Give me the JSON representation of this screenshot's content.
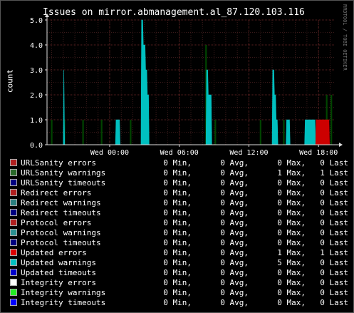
{
  "title": "Issues on mirror.abmanagement.al_87.120.103.116",
  "watermark": "RRDTOOL / TOBI OETIKER",
  "chart_data": {
    "type": "area",
    "ylabel": "count",
    "ylim": [
      0,
      5.0
    ],
    "yticks": [
      "0.0",
      "1.0",
      "2.0",
      "3.0",
      "4.0",
      "5.0"
    ],
    "xticks": [
      {
        "label": "Wed 00:00",
        "t": 5
      },
      {
        "label": "Wed 06:00",
        "t": 11
      },
      {
        "label": "Wed 12:00",
        "t": 17
      },
      {
        "label": "Wed 18:00",
        "t": 23
      }
    ],
    "xrange": [
      -0.4,
      24.4
    ],
    "grid": true,
    "series": [
      {
        "name": "URLSanity warnings",
        "color": "#004400",
        "style": "bars",
        "points": [
          [
            0.0,
            1.0
          ],
          [
            1.1,
            1.0
          ],
          [
            2.7,
            1.0
          ],
          [
            4.3,
            1.0
          ],
          [
            6.8,
            1.0
          ],
          [
            13.3,
            4.0
          ],
          [
            14.1,
            1.0
          ],
          [
            18.0,
            1.0
          ],
          [
            19.2,
            1.0
          ],
          [
            20.0,
            1.0
          ],
          [
            23.7,
            2.0
          ],
          [
            24.1,
            2.0
          ]
        ]
      },
      {
        "name": "Updated warnings",
        "color": "#00c0c0",
        "style": "area",
        "points": [
          [
            1.0,
            0
          ],
          [
            1.05,
            3.0
          ],
          [
            1.12,
            0
          ],
          [
            5.5,
            0
          ],
          [
            5.55,
            1.0
          ],
          [
            5.85,
            1.0
          ],
          [
            5.9,
            0
          ],
          [
            7.7,
            0
          ],
          [
            7.75,
            5.0
          ],
          [
            7.85,
            5.0
          ],
          [
            7.9,
            4.0
          ],
          [
            8.05,
            4.0
          ],
          [
            8.1,
            3.0
          ],
          [
            8.2,
            3.0
          ],
          [
            8.25,
            2.0
          ],
          [
            8.35,
            2.0
          ],
          [
            8.4,
            0
          ],
          [
            13.3,
            0
          ],
          [
            13.35,
            3.0
          ],
          [
            13.45,
            3.0
          ],
          [
            13.5,
            2.0
          ],
          [
            13.75,
            2.0
          ],
          [
            13.8,
            0
          ],
          [
            19.0,
            0
          ],
          [
            19.05,
            3.0
          ],
          [
            19.15,
            3.0
          ],
          [
            19.2,
            2.0
          ],
          [
            19.3,
            2.0
          ],
          [
            19.35,
            1.0
          ],
          [
            19.45,
            1.0
          ],
          [
            19.5,
            0
          ],
          [
            20.2,
            0
          ],
          [
            20.25,
            1.0
          ],
          [
            20.5,
            1.0
          ],
          [
            20.55,
            0
          ],
          [
            21.8,
            0
          ],
          [
            21.85,
            1.0
          ],
          [
            22.7,
            1.0
          ],
          [
            22.75,
            0
          ]
        ]
      },
      {
        "name": "Updated errors",
        "color": "#cc0000",
        "style": "area",
        "points": [
          [
            22.75,
            0
          ],
          [
            22.8,
            1.0
          ],
          [
            23.9,
            1.0
          ],
          [
            23.95,
            0
          ]
        ]
      }
    ]
  },
  "legend": [
    {
      "name": "URLSanity errors",
      "color": "#b02020",
      "min": "0 Min,",
      "avg": "0 Avg,",
      "max": "0 Max,",
      "last": "0 Last"
    },
    {
      "name": "URLSanity warnings",
      "color": "#2a6a2a",
      "min": "0 Min,",
      "avg": "0 Avg,",
      "max": "1 Max,",
      "last": "1 Last"
    },
    {
      "name": "URLSanity timeouts",
      "color": "#000080",
      "min": "0 Min,",
      "avg": "0 Avg,",
      "max": "0 Max,",
      "last": "0 Last"
    },
    {
      "name": "Redirect errors",
      "color": "#b02020",
      "min": "0 Min,",
      "avg": "0 Avg,",
      "max": "0 Max,",
      "last": "0 Last"
    },
    {
      "name": "Redirect warnings",
      "color": "#2a8080",
      "min": "0 Min,",
      "avg": "0 Avg,",
      "max": "0 Max,",
      "last": "0 Last"
    },
    {
      "name": "Redirect timeouts",
      "color": "#000080",
      "min": "0 Min,",
      "avg": "0 Avg,",
      "max": "0 Max,",
      "last": "0 Last"
    },
    {
      "name": "Protocol errors",
      "color": "#b02020",
      "min": "0 Min,",
      "avg": "0 Avg,",
      "max": "0 Max,",
      "last": "0 Last"
    },
    {
      "name": "Protocol warnings",
      "color": "#2a9090",
      "min": "0 Min,",
      "avg": "0 Avg,",
      "max": "0 Max,",
      "last": "0 Last"
    },
    {
      "name": "Protocol timeouts",
      "color": "#000080",
      "min": "0 Min,",
      "avg": "0 Avg,",
      "max": "0 Max,",
      "last": "0 Last"
    },
    {
      "name": "Updated errors",
      "color": "#dd0000",
      "min": "0 Min,",
      "avg": "0 Avg,",
      "max": "1 Max,",
      "last": "1 Last"
    },
    {
      "name": "Updated warnings",
      "color": "#00c0c0",
      "min": "0 Min,",
      "avg": "0 Avg,",
      "max": "5 Max,",
      "last": "0 Last"
    },
    {
      "name": "Updated timeouts",
      "color": "#0000cc",
      "min": "0 Min,",
      "avg": "0 Avg,",
      "max": "0 Max,",
      "last": "0 Last"
    },
    {
      "name": "Integrity errors",
      "color": "#ffffff",
      "min": "0 Min,",
      "avg": "0 Avg,",
      "max": "0 Max,",
      "last": "0 Last"
    },
    {
      "name": "Integrity warnings",
      "color": "#22ee22",
      "min": "0 Min,",
      "avg": "0 Avg,",
      "max": "0 Max,",
      "last": "0 Last"
    },
    {
      "name": "Integrity timeouts",
      "color": "#0000ff",
      "min": "0 Min,",
      "avg": "0 Avg,",
      "max": "0 Max,",
      "last": "0 Last"
    }
  ]
}
